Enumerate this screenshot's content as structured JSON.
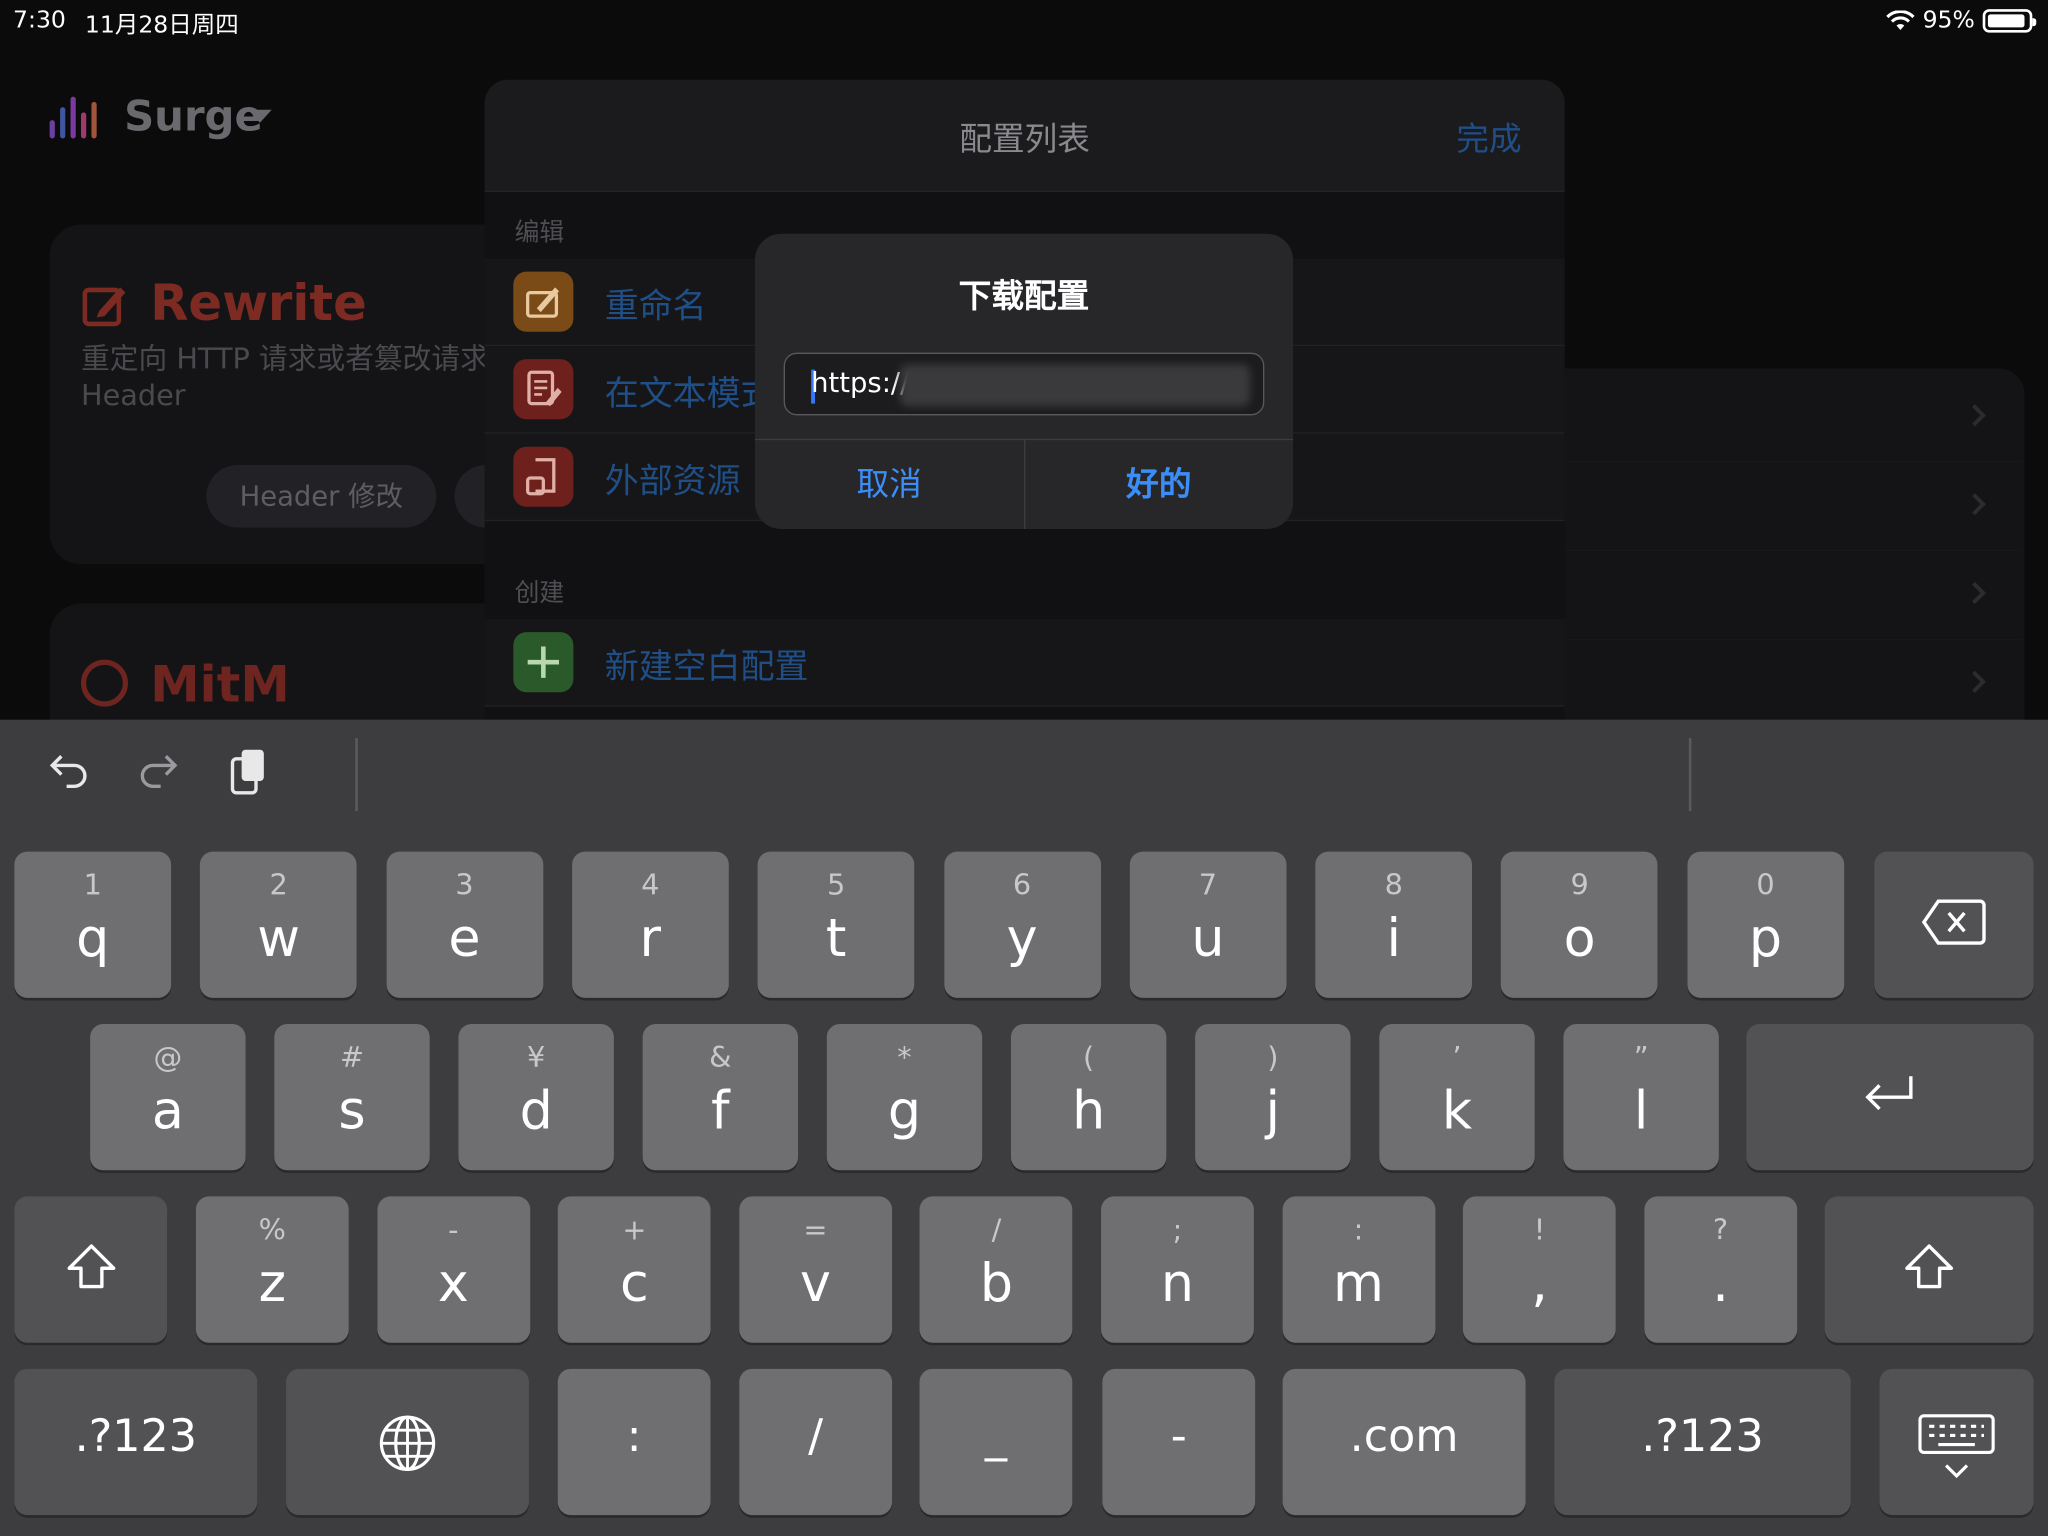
{
  "status": {
    "time": "7:30",
    "date": "11月28日周四",
    "battery": "95%"
  },
  "app": {
    "name": "Surge",
    "rewrite_title": "Rewrite",
    "rewrite_desc": "重定向 HTTP 请求或者篡改请求 Header",
    "header_pill": "Header 修改",
    "mitm_title": "MitM"
  },
  "sheet": {
    "title": "配置列表",
    "done": "完成",
    "edit_section": "编辑",
    "edit_items": [
      {
        "label": "重命名",
        "icon": "pencil-icon",
        "color": "#7a4b17"
      },
      {
        "label": "在文本模式",
        "icon": "text-document-icon",
        "color": "#6e201c"
      },
      {
        "label": "外部资源",
        "icon": "external-resource-icon",
        "color": "#6e201c"
      }
    ],
    "create_section": "创建",
    "create_items": [
      {
        "label": "新建空白配置",
        "icon": "plus-icon",
        "color": "#2b5a2a"
      }
    ]
  },
  "alert": {
    "title": "下载配置",
    "field_value": "https://",
    "cancel": "取消",
    "ok": "好的"
  },
  "keyboard": {
    "row1": [
      [
        "1",
        "q"
      ],
      [
        "2",
        "w"
      ],
      [
        "3",
        "e"
      ],
      [
        "4",
        "r"
      ],
      [
        "5",
        "t"
      ],
      [
        "6",
        "y"
      ],
      [
        "7",
        "u"
      ],
      [
        "8",
        "i"
      ],
      [
        "9",
        "o"
      ],
      [
        "0",
        "p"
      ]
    ],
    "row2": [
      [
        "@",
        "a"
      ],
      [
        "#",
        "s"
      ],
      [
        "¥",
        "d"
      ],
      [
        "&",
        "f"
      ],
      [
        "*",
        "g"
      ],
      [
        "(",
        "h"
      ],
      [
        ")",
        "j"
      ],
      [
        "’",
        "k"
      ],
      [
        "”",
        "l"
      ]
    ],
    "row3": [
      [
        "%",
        "z"
      ],
      [
        "-",
        "x"
      ],
      [
        "+",
        "c"
      ],
      [
        "=",
        "v"
      ],
      [
        "/",
        "b"
      ],
      [
        ";",
        "n"
      ],
      [
        ":",
        "m"
      ],
      [
        "!",
        ","
      ],
      [
        "?",
        "."
      ]
    ],
    "row4": [
      ".?123",
      ":",
      "/",
      "_",
      "-",
      ".com",
      ".?123"
    ]
  }
}
